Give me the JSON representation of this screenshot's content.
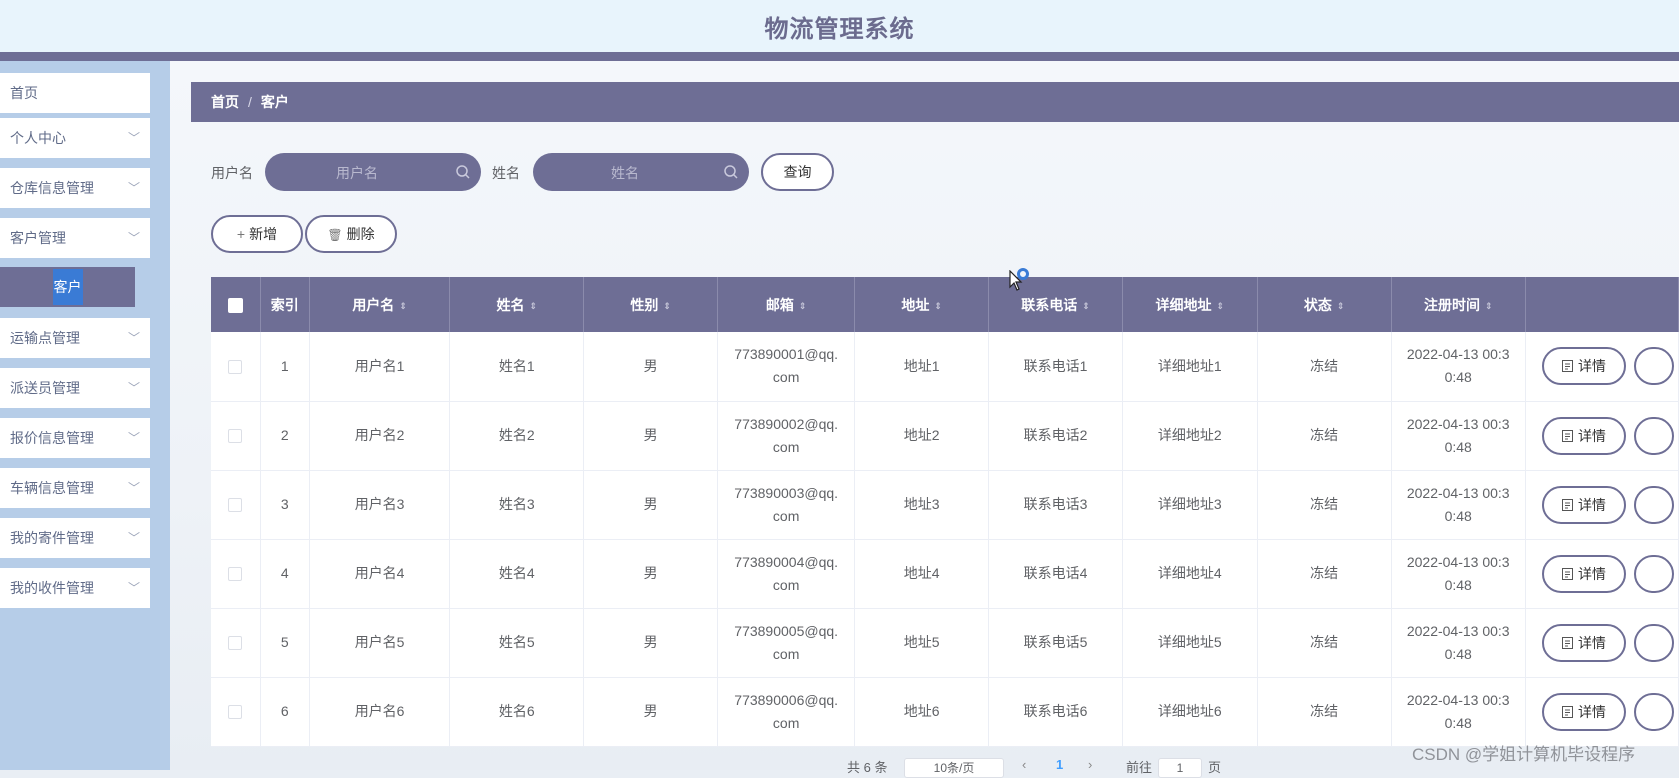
{
  "app": {
    "title": "物流管理系统"
  },
  "sidebar": {
    "items": [
      {
        "label": "首页",
        "has_children": false
      },
      {
        "label": "个人中心",
        "has_children": true
      },
      {
        "label": "仓库信息管理",
        "has_children": true
      },
      {
        "label": "客户管理",
        "has_children": true
      },
      {
        "label": "运输点管理",
        "has_children": true
      },
      {
        "label": "派送员管理",
        "has_children": true
      },
      {
        "label": "报价信息管理",
        "has_children": true
      },
      {
        "label": "车辆信息管理",
        "has_children": true
      },
      {
        "label": "我的寄件管理",
        "has_children": true
      },
      {
        "label": "我的收件管理",
        "has_children": true
      }
    ],
    "active_submenu": "客户",
    "chevron_glyph": "﹀"
  },
  "breadcrumb": {
    "home": "首页",
    "separator": "/",
    "current": "客户"
  },
  "search": {
    "username_label": "用户名",
    "username_placeholder": "用户名",
    "name_label": "姓名",
    "name_placeholder": "姓名",
    "query_button": "查询"
  },
  "toolbar": {
    "add_label": "新增",
    "add_icon": "+",
    "delete_label": "删除",
    "delete_icon": "🗑"
  },
  "table": {
    "columns": [
      "索引",
      "用户名",
      "姓名",
      "性别",
      "邮箱",
      "地址",
      "联系电话",
      "详细地址",
      "状态",
      "注册时间"
    ],
    "rows": [
      {
        "index": "1",
        "username": "用户名1",
        "name": "姓名1",
        "gender": "男",
        "email_1": "773890001@qq.",
        "email_2": "com",
        "address": "地址1",
        "phone": "联系电话1",
        "detail_address": "详细地址1",
        "status": "冻结",
        "time_1": "2022-04-13 00:3",
        "time_2": "0:48"
      },
      {
        "index": "2",
        "username": "用户名2",
        "name": "姓名2",
        "gender": "男",
        "email_1": "773890002@qq.",
        "email_2": "com",
        "address": "地址2",
        "phone": "联系电话2",
        "detail_address": "详细地址2",
        "status": "冻结",
        "time_1": "2022-04-13 00:3",
        "time_2": "0:48"
      },
      {
        "index": "3",
        "username": "用户名3",
        "name": "姓名3",
        "gender": "男",
        "email_1": "773890003@qq.",
        "email_2": "com",
        "address": "地址3",
        "phone": "联系电话3",
        "detail_address": "详细地址3",
        "status": "冻结",
        "time_1": "2022-04-13 00:3",
        "time_2": "0:48"
      },
      {
        "index": "4",
        "username": "用户名4",
        "name": "姓名4",
        "gender": "男",
        "email_1": "773890004@qq.",
        "email_2": "com",
        "address": "地址4",
        "phone": "联系电话4",
        "detail_address": "详细地址4",
        "status": "冻结",
        "time_1": "2022-04-13 00:3",
        "time_2": "0:48"
      },
      {
        "index": "5",
        "username": "用户名5",
        "name": "姓名5",
        "gender": "男",
        "email_1": "773890005@qq.",
        "email_2": "com",
        "address": "地址5",
        "phone": "联系电话5",
        "detail_address": "详细地址5",
        "status": "冻结",
        "time_1": "2022-04-13 00:3",
        "time_2": "0:48"
      },
      {
        "index": "6",
        "username": "用户名6",
        "name": "姓名6",
        "gender": "男",
        "email_1": "773890006@qq.",
        "email_2": "com",
        "address": "地址6",
        "phone": "联系电话6",
        "detail_address": "详细地址6",
        "status": "冻结",
        "time_1": "2022-04-13 00:3",
        "time_2": "0:48"
      }
    ],
    "detail_button": "详情",
    "sort_glyph": "⇕"
  },
  "pagination": {
    "total_prefix": "共 6 条",
    "page_size": "10条/页",
    "current_page": "1",
    "goto_label": "前往",
    "goto_value": "1",
    "page_suffix": "页"
  },
  "watermark": "CSDN @学姐计算机毕设程序",
  "colors": {
    "accent": "#6e6e95",
    "sidebar_bg": "#b6cde8",
    "header_bg": "#e8f4fc",
    "highlight": "#3a7bd5"
  }
}
